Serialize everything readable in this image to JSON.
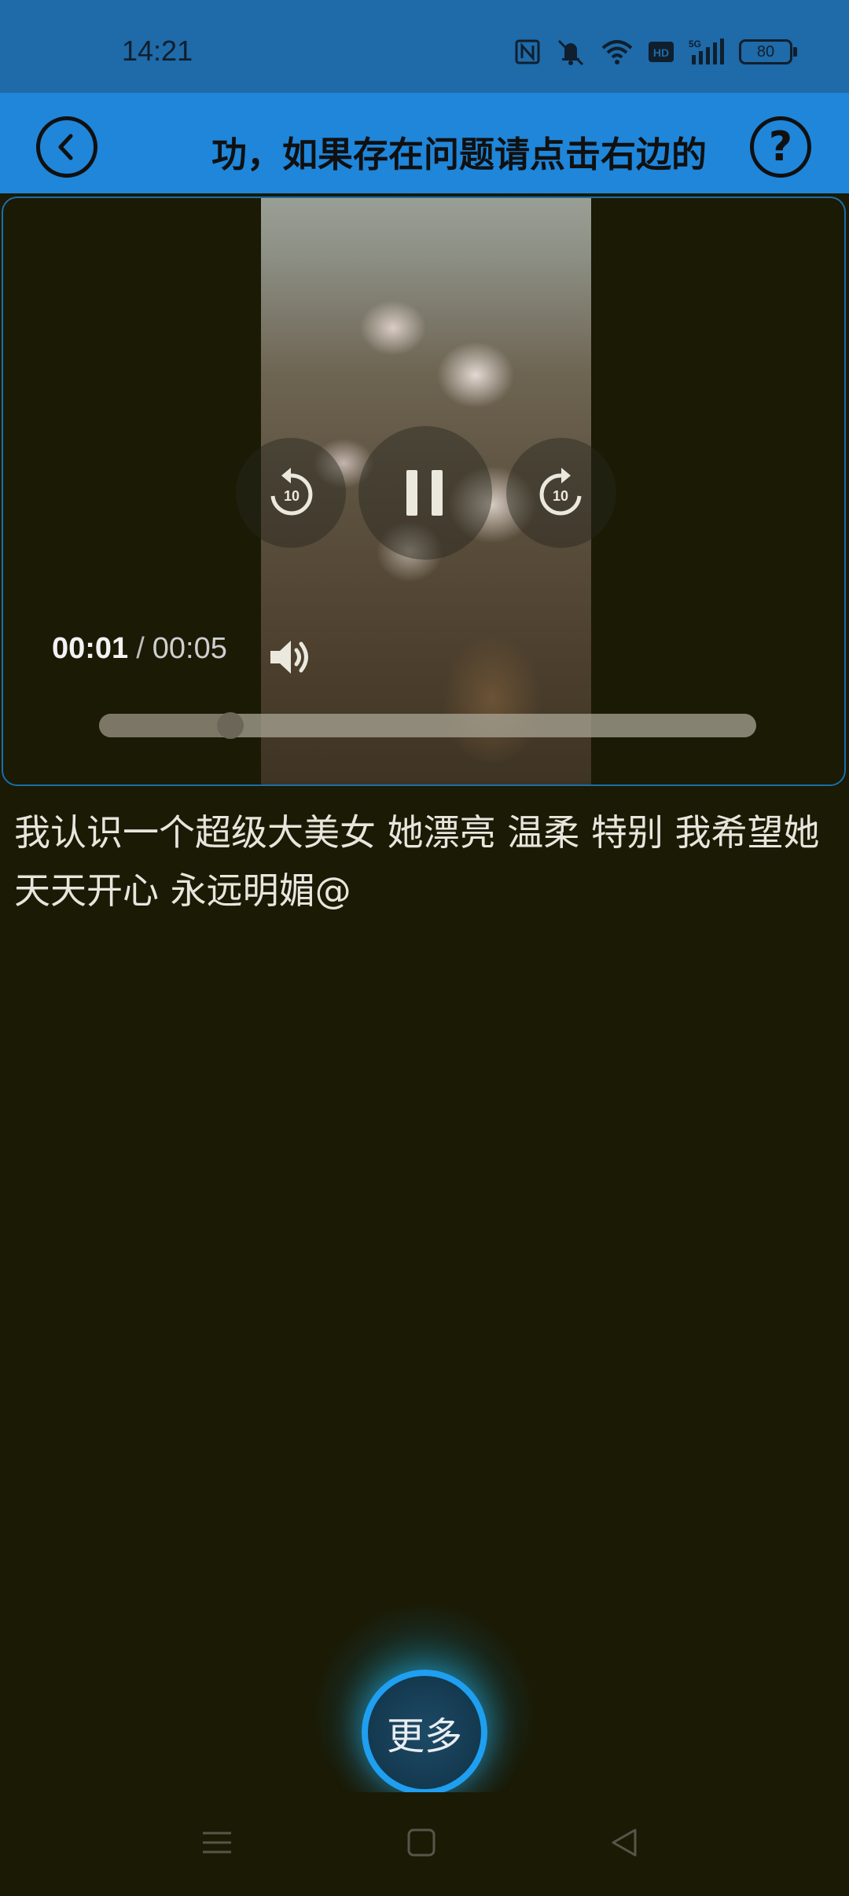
{
  "status_bar": {
    "time": "14:21",
    "battery": "80",
    "icons": [
      "nfc-icon",
      "mute-icon",
      "wifi-icon",
      "hd-icon",
      "signal-5g-icon",
      "battery-icon"
    ]
  },
  "top_bar": {
    "marquee_text": "功，如果存在问题请点击右边的【",
    "back_icon": "chevron-left-icon",
    "help_label": "?"
  },
  "player": {
    "current_time": "00:01",
    "separator": "/",
    "total_time": "00:05",
    "progress": 0.2,
    "rewind_label": "10",
    "forward_label": "10",
    "state": "playing"
  },
  "caption": "我认识一个超级大美女 她漂亮 温柔 特别 我希望她天天开心 永远明媚@",
  "more_button": {
    "label": "更多"
  },
  "nav_bar": {
    "items": [
      "menu-icon",
      "home-icon",
      "back-icon"
    ]
  },
  "colors": {
    "status_bar_bg": "#1f6aa8",
    "top_bar_bg": "#1f86da",
    "page_bg": "#1a1a05",
    "accent_blue": "#1f9ff0"
  }
}
